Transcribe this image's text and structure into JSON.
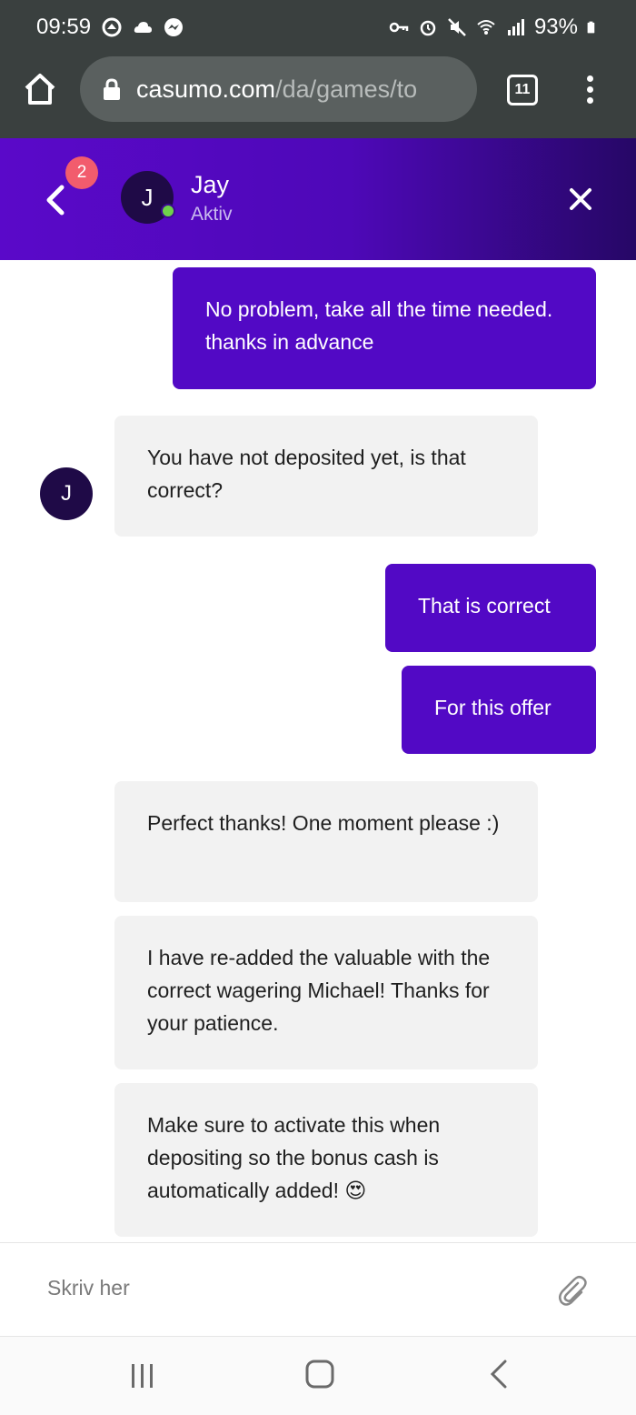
{
  "status_bar": {
    "time": "09:59",
    "battery": "93%",
    "left_icons": [
      "signal-app-icon",
      "cloud-icon",
      "messenger-icon"
    ],
    "right_icons": [
      "key-icon",
      "alarm-icon",
      "mute-icon",
      "wifi-icon",
      "cell-signal-icon",
      "battery-icon"
    ]
  },
  "browser": {
    "url_domain": "casumo.com",
    "url_path": "/da/games/to",
    "tab_count": "11"
  },
  "chat_header": {
    "badge_count": "2",
    "agent_initial": "J",
    "agent_name": "Jay",
    "agent_status": "Aktiv"
  },
  "messages": [
    {
      "from": "me",
      "text": "No problem, take all the time needed. thanks in advance"
    },
    {
      "from": "them",
      "text": "You have not deposited yet, is that correct?",
      "avatar": "J"
    },
    {
      "from": "me",
      "text": "That is correct"
    },
    {
      "from": "me",
      "text": "For this offer"
    },
    {
      "from": "them",
      "text": "Perfect thanks! One moment please :)"
    },
    {
      "from": "them",
      "text": "I have re-added the valuable with the correct wagering Michael! Thanks for your patience."
    },
    {
      "from": "them",
      "text": "Make sure to activate this when depositing so the bonus cash is automatically added! 😍"
    }
  ],
  "composer": {
    "placeholder": "Skriv her"
  },
  "colors": {
    "accent": "#5209c5",
    "header_gradient_end": "#260766",
    "badge": "#f25c6d",
    "online": "#6fd24a"
  }
}
